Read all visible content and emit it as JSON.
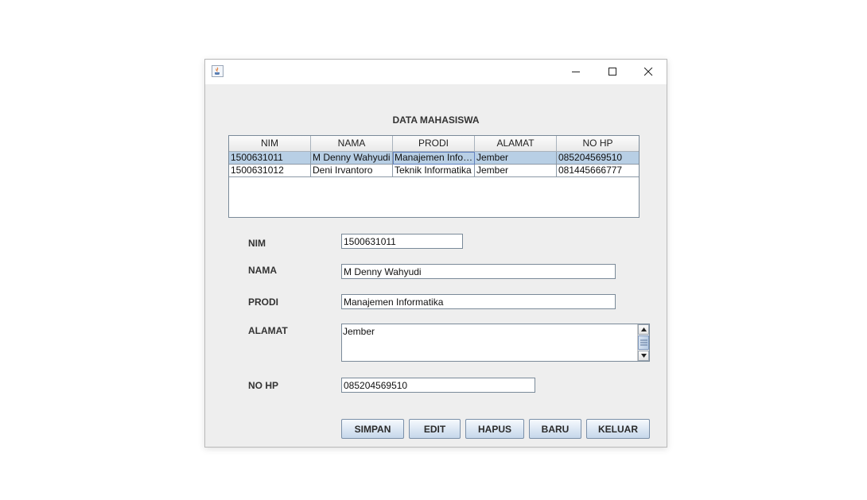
{
  "window": {
    "icon": "java-coffee-icon",
    "controls": {
      "minimize": "minimize-icon",
      "maximize": "maximize-icon",
      "close": "close-icon"
    }
  },
  "heading": "DATA MAHASISWA",
  "table": {
    "columns": [
      "NIM",
      "NAMA",
      "PRODI",
      "ALAMAT",
      "NO HP"
    ],
    "rows": [
      [
        "1500631011",
        "M Denny Wahyudi",
        "Manajemen Informatika",
        "Jember",
        "085204569510"
      ],
      [
        "1500631012",
        "Deni Irvantoro",
        "Teknik Informatika",
        "Jember",
        "081445666777"
      ]
    ],
    "selected_row": 0
  },
  "form": {
    "nim": {
      "label": "NIM",
      "value": "1500631011"
    },
    "nama": {
      "label": "NAMA",
      "value": "M Denny Wahyudi"
    },
    "prodi": {
      "label": "PRODI",
      "value": "Manajemen Informatika"
    },
    "alamat": {
      "label": "ALAMAT",
      "value": "Jember"
    },
    "nohp": {
      "label": "NO HP",
      "value": "085204569510"
    }
  },
  "buttons": {
    "simpan": "SIMPAN",
    "edit": "EDIT",
    "hapus": "HAPUS",
    "baru": "BARU",
    "keluar": "KELUAR"
  },
  "colors": {
    "window_bg": "#eeeeee",
    "selection": "#b8cfe5",
    "button_gradient_bottom": "#c6d7ea"
  }
}
